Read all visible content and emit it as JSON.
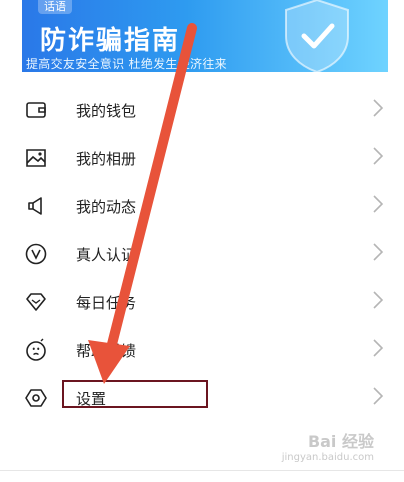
{
  "banner": {
    "tag": "话语",
    "title": "防诈骗指南",
    "subtitle": "提高交友安全意识 杜绝发生经济往来"
  },
  "menu": [
    {
      "label": "我的钱包",
      "icon": "wallet-icon"
    },
    {
      "label": "我的相册",
      "icon": "photo-album-icon"
    },
    {
      "label": "我的动态",
      "icon": "megaphone-icon"
    },
    {
      "label": "真人认证",
      "icon": "verify-v-icon"
    },
    {
      "label": "每日任务",
      "icon": "diamond-icon"
    },
    {
      "label": "帮助反馈",
      "icon": "help-face-icon"
    },
    {
      "label": "设置",
      "icon": "settings-hexagon-icon"
    }
  ],
  "watermark": {
    "text": "Bai 经验",
    "sub": "jingyan.baidu.com"
  },
  "colors": {
    "annotation_arrow": "#e8533a",
    "highlight_box": "#6b1520"
  }
}
